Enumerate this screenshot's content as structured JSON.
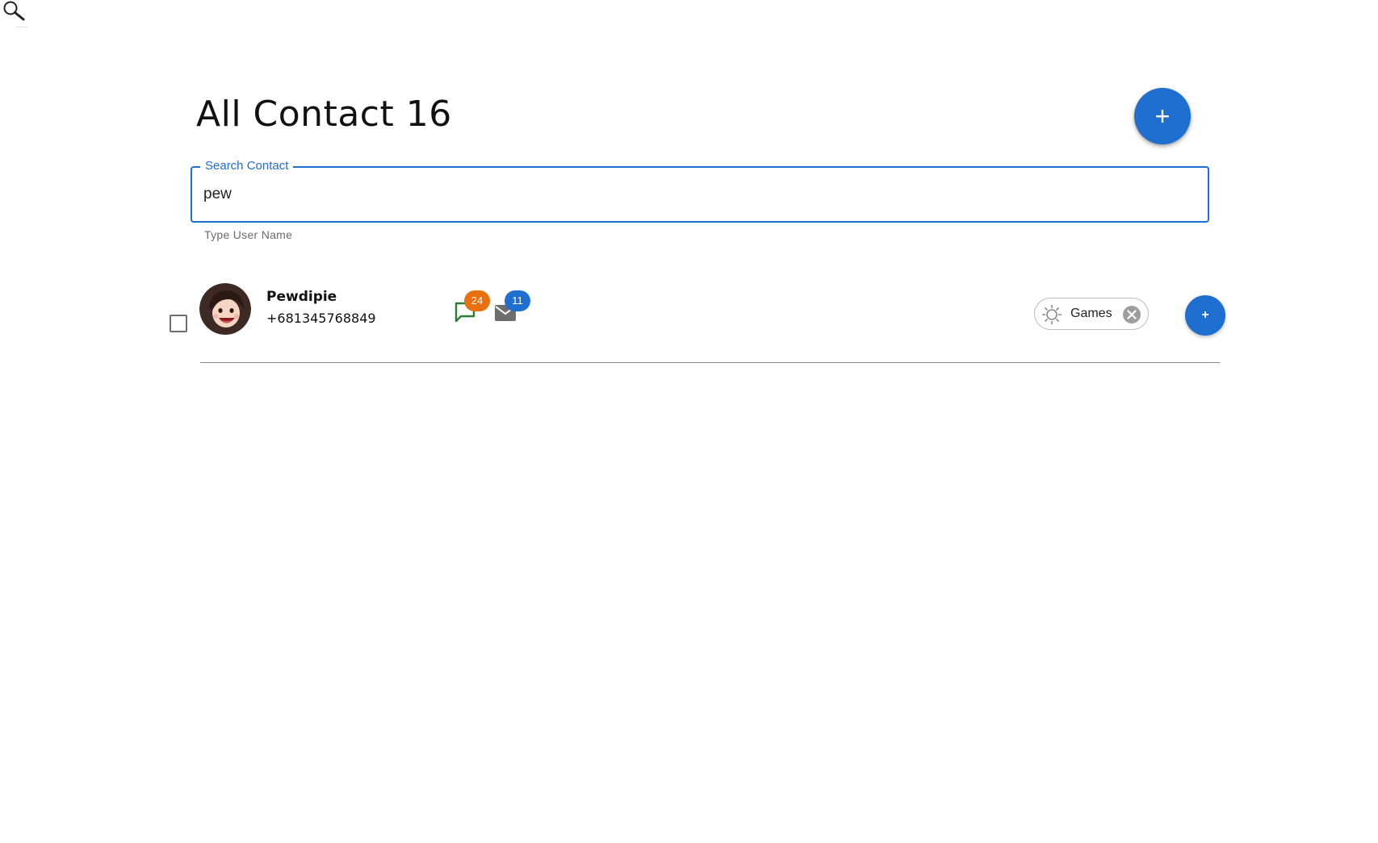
{
  "header": {
    "title": "All Contact 16",
    "add_button_label": "+",
    "add_button_color": "#1f6fd1"
  },
  "search": {
    "label": "Search Contact",
    "value": "pew",
    "helper_text": "Type User Name",
    "accent_color": "#1f6fd1"
  },
  "contacts": [
    {
      "name": "Pewdipie",
      "phone": "+681345768849",
      "checked": false,
      "avatar_icon": "cartoon-face-avatar",
      "messages": {
        "icon": "chat-bubble-icon",
        "count": "24",
        "color": "#e8700e"
      },
      "emails": {
        "icon": "mail-icon",
        "count": "11",
        "color": "#1f6fd1"
      },
      "tag": {
        "label": "Games",
        "icon": "sun-icon"
      },
      "add_label": "+"
    }
  ],
  "icons": {
    "top_search": "magnifier-icon"
  }
}
